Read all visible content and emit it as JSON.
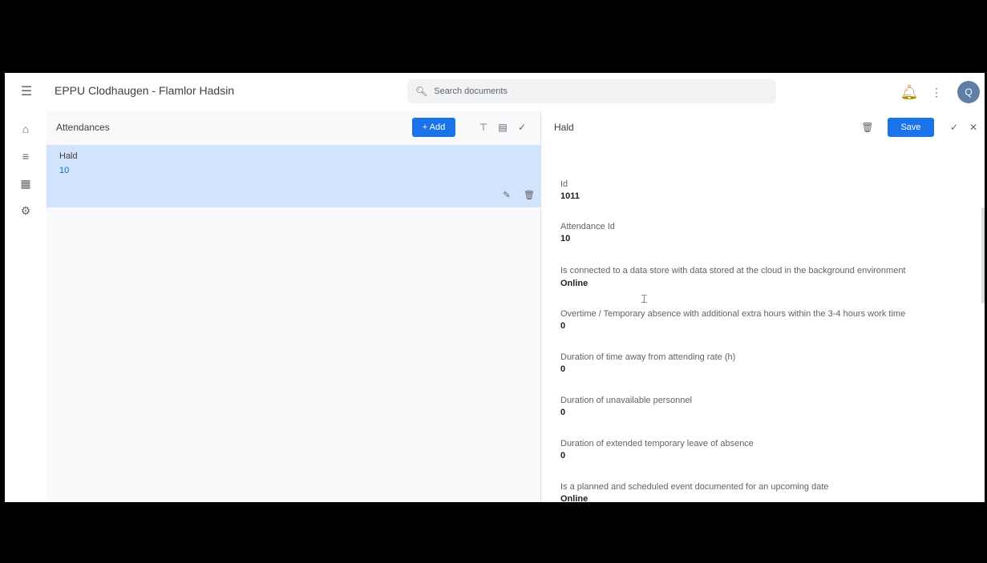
{
  "topbar": {
    "title": "EPPU Clodhaugen - Flamlor Hadsin",
    "search_placeholder": "Search documents",
    "avatar_initial": "Q"
  },
  "icons": {
    "menu": "hamburger-menu-icon",
    "search": "search-icon",
    "notification": "bell-icon",
    "more": "more-vert-icon"
  },
  "sidebar": {
    "items": [
      {
        "icon": "home-icon"
      },
      {
        "icon": "list-icon"
      },
      {
        "icon": "calendar-icon"
      },
      {
        "icon": "settings-icon"
      }
    ]
  },
  "left_pane": {
    "title": "Attendances",
    "primary_button": "+ Add",
    "selected_item": {
      "name": "Hald",
      "sub": "10"
    }
  },
  "right_pane": {
    "title": "Hald",
    "primary_button": "Save",
    "fields": [
      {
        "label": "Id",
        "value": "1011"
      },
      {
        "label": "Attendance Id",
        "value": "10"
      },
      {
        "label": "Is connected to a data store with data stored at the cloud in the background environment",
        "value": "Online"
      },
      {
        "label": "Overtime / Temporary absence with additional extra hours within the 3-4 hours work time",
        "value": "0"
      },
      {
        "label": "Duration of time away from attending rate (h)",
        "value": "0"
      },
      {
        "label": "Duration of unavailable personnel",
        "value": "0"
      },
      {
        "label": "Duration of extended temporary leave of absence",
        "value": "0"
      },
      {
        "label": "Is a planned and scheduled event documented for an upcoming date",
        "value": "Online"
      }
    ]
  },
  "colors": {
    "accent": "#1a73e8",
    "selected": "#d2e3fc",
    "pane_bg": "#f8f9fa"
  }
}
